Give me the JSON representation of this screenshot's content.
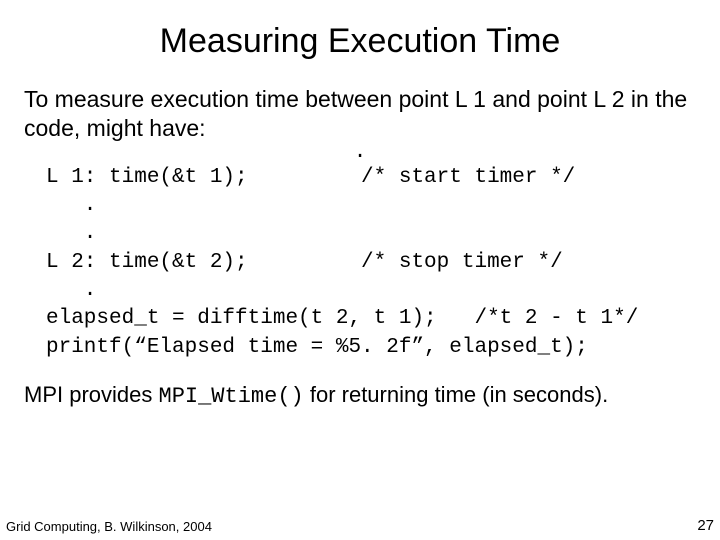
{
  "title": "Measuring Execution Time",
  "intro": "To measure execution time between point L 1 and point L 2 in the code, might have:",
  "dot0": ".",
  "code": {
    "l1": "L 1: time(&t 1);         /* start timer */",
    "d1": "   .",
    "d2": "   .",
    "l2": "L 2: time(&t 2);         /* stop timer */",
    "d3": "   .",
    "el": "elapsed_t = difftime(t 2, t 1);   /*t 2 - t 1*/",
    "pr": "printf(“Elapsed time = %5. 2f”, elapsed_t);"
  },
  "outro_pre": "MPI provides ",
  "outro_mono": "MPI_Wtime()",
  "outro_post": " for returning time (in seconds).",
  "footer_left": "Grid Computing, B. Wilkinson, 2004",
  "footer_right": "27"
}
